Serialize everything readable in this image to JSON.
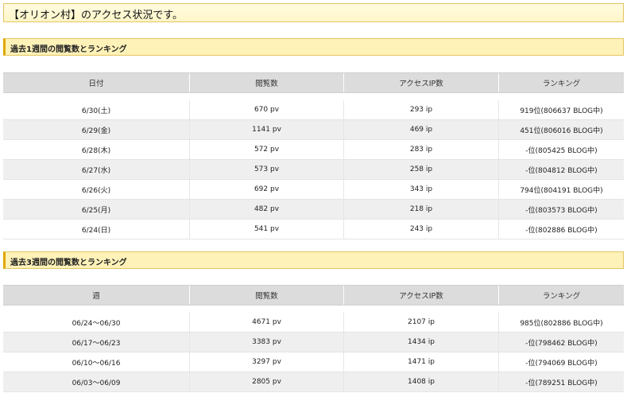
{
  "page_title": "【オリオン村】のアクセス状況です。",
  "weekly": {
    "heading": "過去1週間の閲覧数とランキング",
    "columns": [
      "日付",
      "閲覧数",
      "アクセスIP数",
      "ランキング"
    ],
    "rows": [
      [
        "6/30(土)",
        "670 pv",
        "293 ip",
        "919位(806637 BLOG中)"
      ],
      [
        "6/29(金)",
        "1141 pv",
        "469 ip",
        "451位(806016 BLOG中)"
      ],
      [
        "6/28(木)",
        "572 pv",
        "283 ip",
        "-位(805425 BLOG中)"
      ],
      [
        "6/27(水)",
        "573 pv",
        "258 ip",
        "-位(804812 BLOG中)"
      ],
      [
        "6/26(火)",
        "692 pv",
        "343 ip",
        "794位(804191 BLOG中)"
      ],
      [
        "6/25(月)",
        "482 pv",
        "218 ip",
        "-位(803573 BLOG中)"
      ],
      [
        "6/24(日)",
        "541 pv",
        "243 ip",
        "-位(802886 BLOG中)"
      ]
    ]
  },
  "three_weeks": {
    "heading": "過去3週間の閲覧数とランキング",
    "columns": [
      "週",
      "閲覧数",
      "アクセスIP数",
      "ランキング"
    ],
    "rows": [
      [
        "06/24〜06/30",
        "4671 pv",
        "2107 ip",
        "985位(802886 BLOG中)"
      ],
      [
        "06/17〜06/23",
        "3383 pv",
        "1434 ip",
        "-位(798462 BLOG中)"
      ],
      [
        "06/10〜06/16",
        "3297 pv",
        "1471 ip",
        "-位(794069 BLOG中)"
      ],
      [
        "06/03〜06/09",
        "2805 pv",
        "1408 ip",
        "-位(789251 BLOG中)"
      ]
    ]
  }
}
